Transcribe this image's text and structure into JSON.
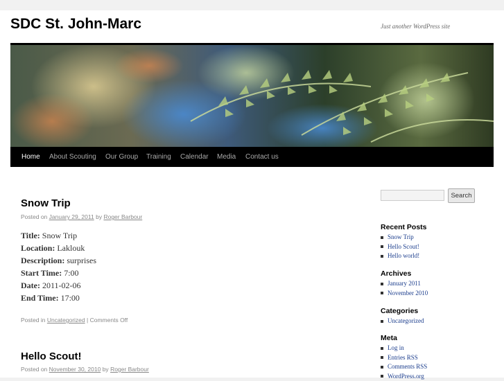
{
  "site": {
    "title": "SDC St. John-Marc",
    "description": "Just another WordPress site"
  },
  "nav": {
    "items": [
      {
        "label": "Home",
        "active": true
      },
      {
        "label": "About Scouting"
      },
      {
        "label": "Our Group"
      },
      {
        "label": "Training"
      },
      {
        "label": "Calendar"
      },
      {
        "label": "Media"
      },
      {
        "label": "Contact us"
      }
    ]
  },
  "posts": [
    {
      "title": "Snow Trip",
      "meta_prefix": "Posted on",
      "date": "January 29, 2011",
      "by": "by",
      "author": "Roger Barbour",
      "fields": [
        {
          "label": "Title:",
          "value": "Snow Trip"
        },
        {
          "label": "Location:",
          "value": "Laklouk"
        },
        {
          "label": "Description:",
          "value": "surprises"
        },
        {
          "label": "Start Time:",
          "value": "7:00"
        },
        {
          "label": "Date:",
          "value": "2011-02-06"
        },
        {
          "label": "End Time:",
          "value": "17:00"
        }
      ],
      "footer_prefix": "Posted in",
      "category": "Uncategorized",
      "separator": "|",
      "comments": "Comments Off"
    },
    {
      "title": "Hello Scout!",
      "meta_prefix": "Posted on",
      "date": "November 30, 2010",
      "by": "by",
      "author": "Roger Barbour"
    }
  ],
  "sidebar": {
    "search_button": "Search",
    "search_value": "",
    "recent_posts": {
      "title": "Recent Posts",
      "items": [
        "Snow Trip",
        "Hello Scout!",
        "Hello world!"
      ]
    },
    "archives": {
      "title": "Archives",
      "items": [
        "January 2011",
        "November 2010"
      ]
    },
    "categories": {
      "title": "Categories",
      "items": [
        "Uncategorized"
      ]
    },
    "meta": {
      "title": "Meta",
      "items": [
        "Log in",
        "Entries RSS",
        "Comments RSS",
        "WordPress.org"
      ]
    }
  },
  "colors": {
    "nav_bg": "#000000",
    "link": "#1a3c8c",
    "page_bg": "#f1f1f1"
  }
}
